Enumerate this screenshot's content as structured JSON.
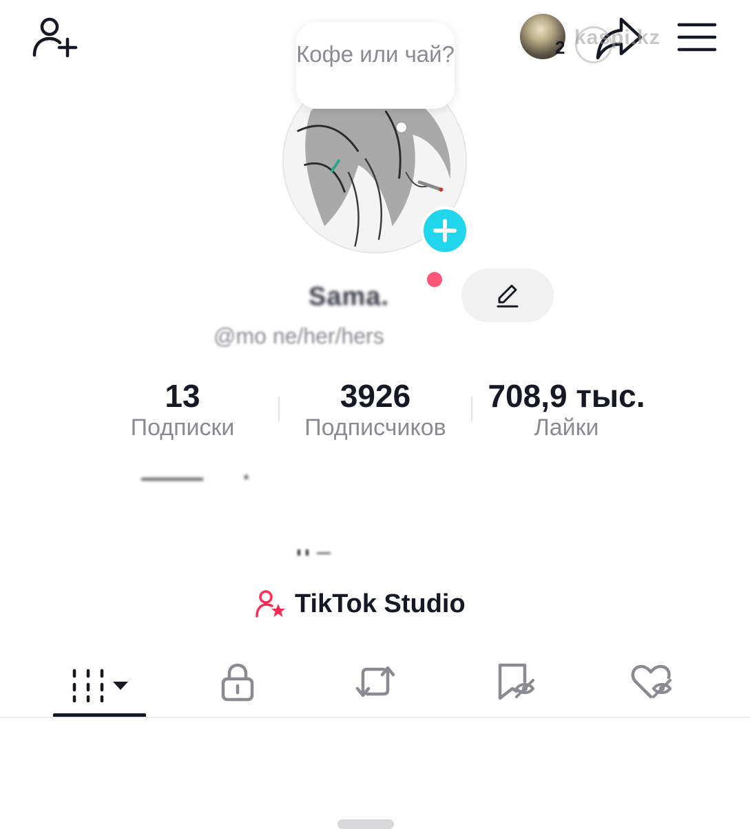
{
  "header": {
    "friends_count": "2",
    "watermark": "kaspi.kz",
    "icons": [
      "add-friend-icon",
      "share-icon",
      "menu-icon"
    ]
  },
  "profile": {
    "note": "Кофе или чай?",
    "display_name": "Sama.",
    "username": "@mo              ne/her/hers"
  },
  "stats": {
    "following_count": "13",
    "following_label": "Подписки",
    "followers_count": "3926",
    "followers_label": "Подписчиков",
    "likes_count": "708,9 тыс.",
    "likes_label": "Лайки"
  },
  "studio": {
    "label": "TikTok Studio"
  },
  "tabs": [
    "videos-grid-icon",
    "lock-icon",
    "repost-icon",
    "favorites-hidden-icon",
    "liked-hidden-icon"
  ],
  "colors": {
    "accent_cyan": "#20d5ec",
    "accent_red": "#fe2c55",
    "text_primary": "#161823",
    "text_secondary": "#8a8b91"
  }
}
